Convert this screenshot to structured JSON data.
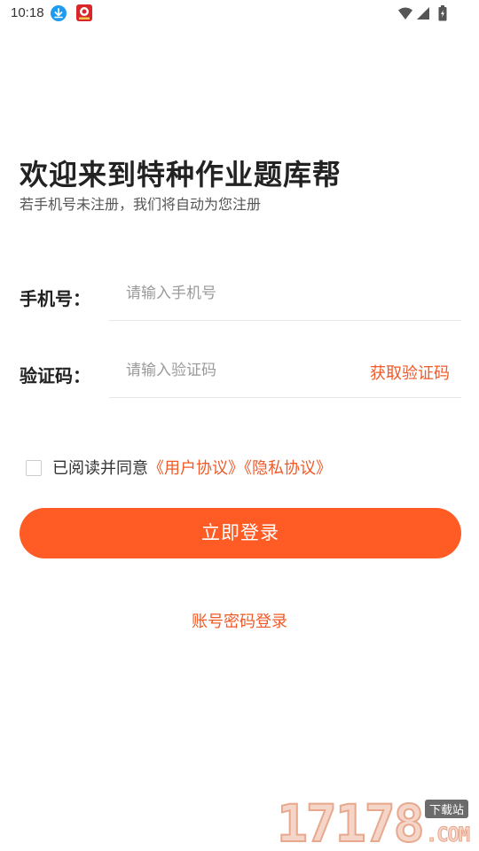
{
  "status_bar": {
    "time": "10:18",
    "icons": [
      "download-icon",
      "app-notification-icon",
      "wifi-icon",
      "signal-icon",
      "battery-icon"
    ]
  },
  "header": {
    "title": "欢迎来到特种作业题库帮",
    "subtitle": "若手机号未注册，我们将自动为您注册"
  },
  "form": {
    "phone": {
      "label": "手机号：",
      "placeholder": "请输入手机号",
      "value": ""
    },
    "code": {
      "label": "验证码：",
      "placeholder": "请输入验证码",
      "value": "",
      "get_code_label": "获取验证码"
    }
  },
  "agreement": {
    "checked": false,
    "prefix": "已阅读并同意",
    "user_agreement": "《用户协议》",
    "privacy_policy": "《隐私协议》"
  },
  "actions": {
    "login_label": "立即登录",
    "password_login_label": "账号密码登录"
  },
  "watermark": {
    "digits": "17178",
    "tag": "下载站",
    "domain": ".COM"
  },
  "colors": {
    "accent": "#ff5b24",
    "link": "#f05a28",
    "title_text": "#222222",
    "subtitle_text": "#555555",
    "placeholder_text": "#9a9a9a",
    "divider": "#e6e6e6"
  }
}
